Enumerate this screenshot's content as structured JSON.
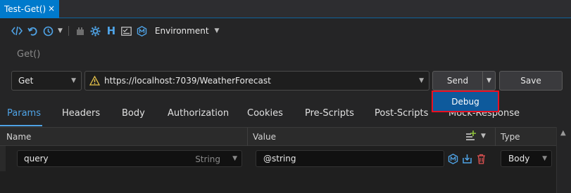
{
  "tab": {
    "title": "Test-Get()",
    "close": "×"
  },
  "toolbar": {
    "environment_label": "Environment",
    "icons": [
      "code-icon",
      "undo-icon",
      "history-icon",
      "chevron-down-icon",
      "plugin-icon",
      "gear-icon",
      "header-icon",
      "variables-icon",
      "mock-icon"
    ]
  },
  "request": {
    "name_placeholder": "Get()",
    "method": "Get",
    "url": "https://localhost:7039/WeatherForecast",
    "send_label": "Send",
    "save_label": "Save",
    "dropdown_item": "Debug"
  },
  "req_tabs": [
    {
      "label": "Params",
      "active": true
    },
    {
      "label": "Headers"
    },
    {
      "label": "Body"
    },
    {
      "label": "Authorization"
    },
    {
      "label": "Cookies"
    },
    {
      "label": "Pre-Scripts"
    },
    {
      "label": "Post-Scripts"
    },
    {
      "label": "Mock-Response"
    }
  ],
  "grid": {
    "headers": {
      "name": "Name",
      "value": "Value",
      "type": "Type"
    },
    "rows": [
      {
        "name": "query",
        "name_type": "String",
        "value": "@string",
        "type": "Body"
      }
    ]
  },
  "colors": {
    "accent": "#007acc",
    "link": "#4fa3e6",
    "dropdown_bg": "#0e5a9c",
    "highlight_border": "#e81123"
  }
}
